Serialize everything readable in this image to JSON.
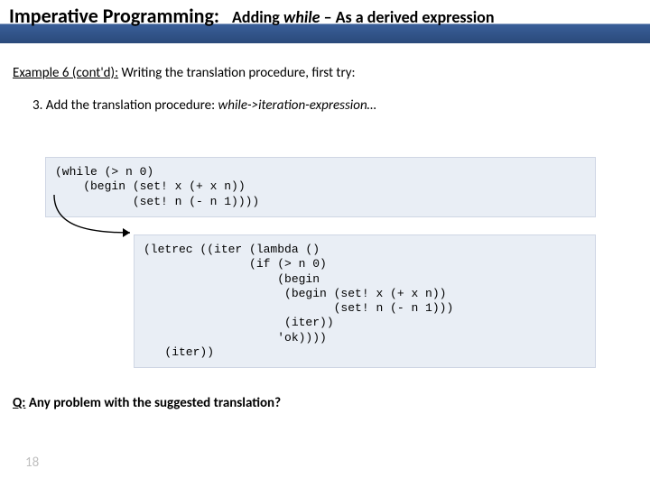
{
  "header": {
    "lhs": "Imperative Programming:",
    "rhs_before": "Adding ",
    "rhs_while": "while",
    "rhs_after": " – As a derived expression"
  },
  "subtitle": {
    "underlined": "Example 6 (cont'd):",
    "rest": " Writing the translation procedure, first try:"
  },
  "step": {
    "prefix": "3. ",
    "text_before": "Add the translation procedure: ",
    "italic": "while->iteration-expression…"
  },
  "code1": "(while (> n 0)\n    (begin (set! x (+ x n))\n           (set! n (- n 1))))",
  "code2": "(letrec ((iter (lambda ()\n               (if (> n 0)\n                   (begin\n                    (begin (set! x (+ x n))\n                           (set! n (- n 1)))\n                    (iter))\n                   'ok))))\n   (iter))",
  "question": {
    "q": "Q:",
    "rest": " Any problem with the suggested translation?"
  },
  "page_number": "18"
}
